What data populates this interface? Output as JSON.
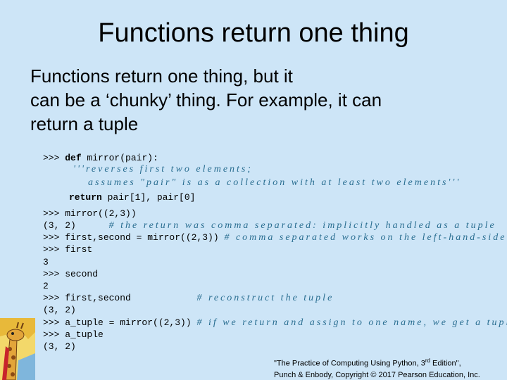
{
  "slide": {
    "title": "Functions return one thing",
    "body_lines": [
      "Functions return one thing, but it",
      "can be a ‘chunky’ thing. For example, it can",
      "return a tuple"
    ]
  },
  "def_block": {
    "prompt": ">>> ",
    "kw_def": "def",
    "signature": " mirror(pair):",
    "doc1": "'''reverses first two elements;",
    "doc2": "assumes \"pair\" is as a collection with at least two elements'''",
    "kw_return": "return",
    "return_expr": " pair[1], pair[0]"
  },
  "session": [
    {
      "code": ">>> mirror((2,3))",
      "comment": ""
    },
    {
      "code": "(3, 2)      ",
      "comment": "# the return was comma separated: implicitly handled as a tuple"
    },
    {
      "code": ">>> first,second = mirror((2,3)) ",
      "comment": "# comma separated works on the left-hand-side also"
    },
    {
      "code": ">>> first",
      "comment": ""
    },
    {
      "code": "3",
      "comment": ""
    },
    {
      "code": ">>> second",
      "comment": ""
    },
    {
      "code": "2",
      "comment": ""
    },
    {
      "code": ">>> first,second            ",
      "comment": "# reconstruct the tuple"
    },
    {
      "code": "(3, 2)",
      "comment": ""
    },
    {
      "code": ">>> a_tuple = mirror((2,3)) ",
      "comment": "# if we return and assign to one name, we get a tuple!"
    },
    {
      "code": ">>> a_tuple",
      "comment": ""
    },
    {
      "code": "(3, 2)",
      "comment": ""
    }
  ],
  "footer": {
    "line1": "\"The Practice of Computing Using Python, 3",
    "line1_sup": "rd",
    "line1_end": " Edition\",",
    "line2": "Punch & Enbody, Copyright © 2017 Pearson Education, Inc."
  },
  "logo": {
    "icon": "giraffe-icon"
  }
}
